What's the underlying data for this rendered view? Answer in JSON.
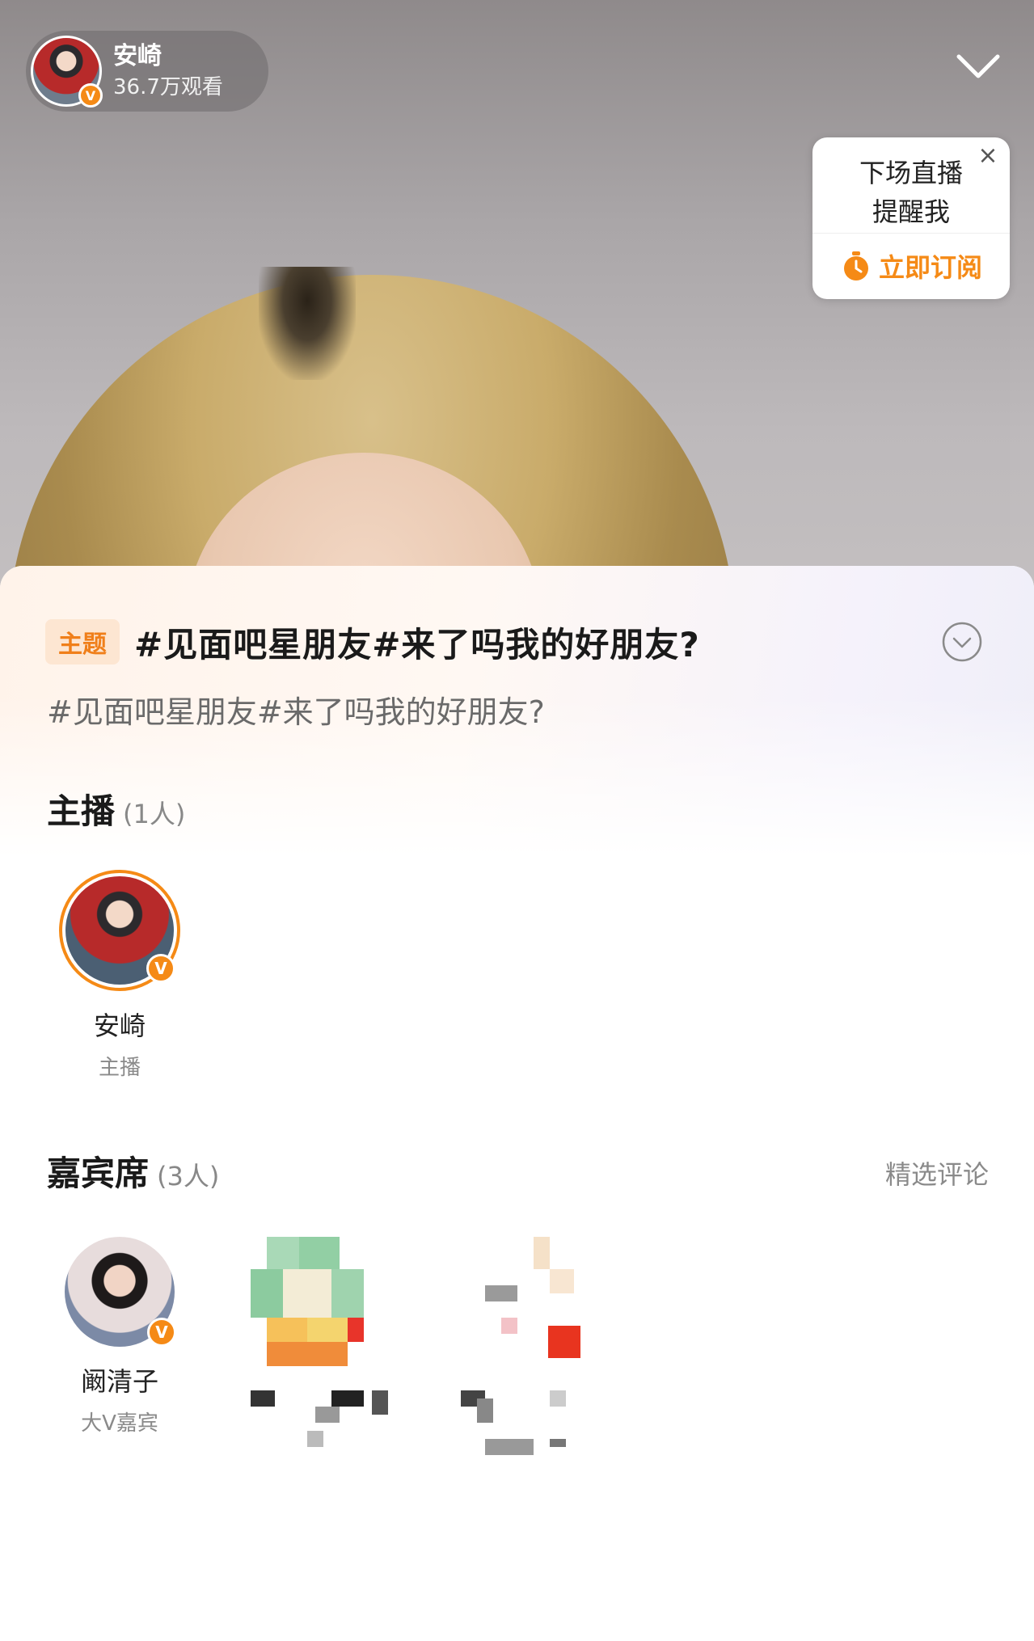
{
  "header": {
    "anchor_name": "安崎",
    "viewers": "36.7万观看",
    "verified_badge": "V"
  },
  "subscribe_card": {
    "line1": "下场直播",
    "line2": "提醒我",
    "action": "立即订阅"
  },
  "topic": {
    "tag": "主题",
    "title": "#见面吧星朋友#来了吗我的好朋友?",
    "description": "#见面吧星朋友#来了吗我的好朋友?"
  },
  "hosts": {
    "title": "主播",
    "count": "(1人)",
    "items": [
      {
        "name": "安崎",
        "role": "主播",
        "badge": "V"
      }
    ]
  },
  "guests": {
    "title": "嘉宾席",
    "count": "(3人)",
    "link": "精选评论",
    "items": [
      {
        "name": "阚清子",
        "role": "大V嘉宾",
        "badge": "V"
      }
    ]
  },
  "colors": {
    "accent": "#f58a16",
    "topic_tag_bg": "#fde6d2",
    "text_primary": "#1a1a1a",
    "text_secondary": "#8a8a8a"
  }
}
